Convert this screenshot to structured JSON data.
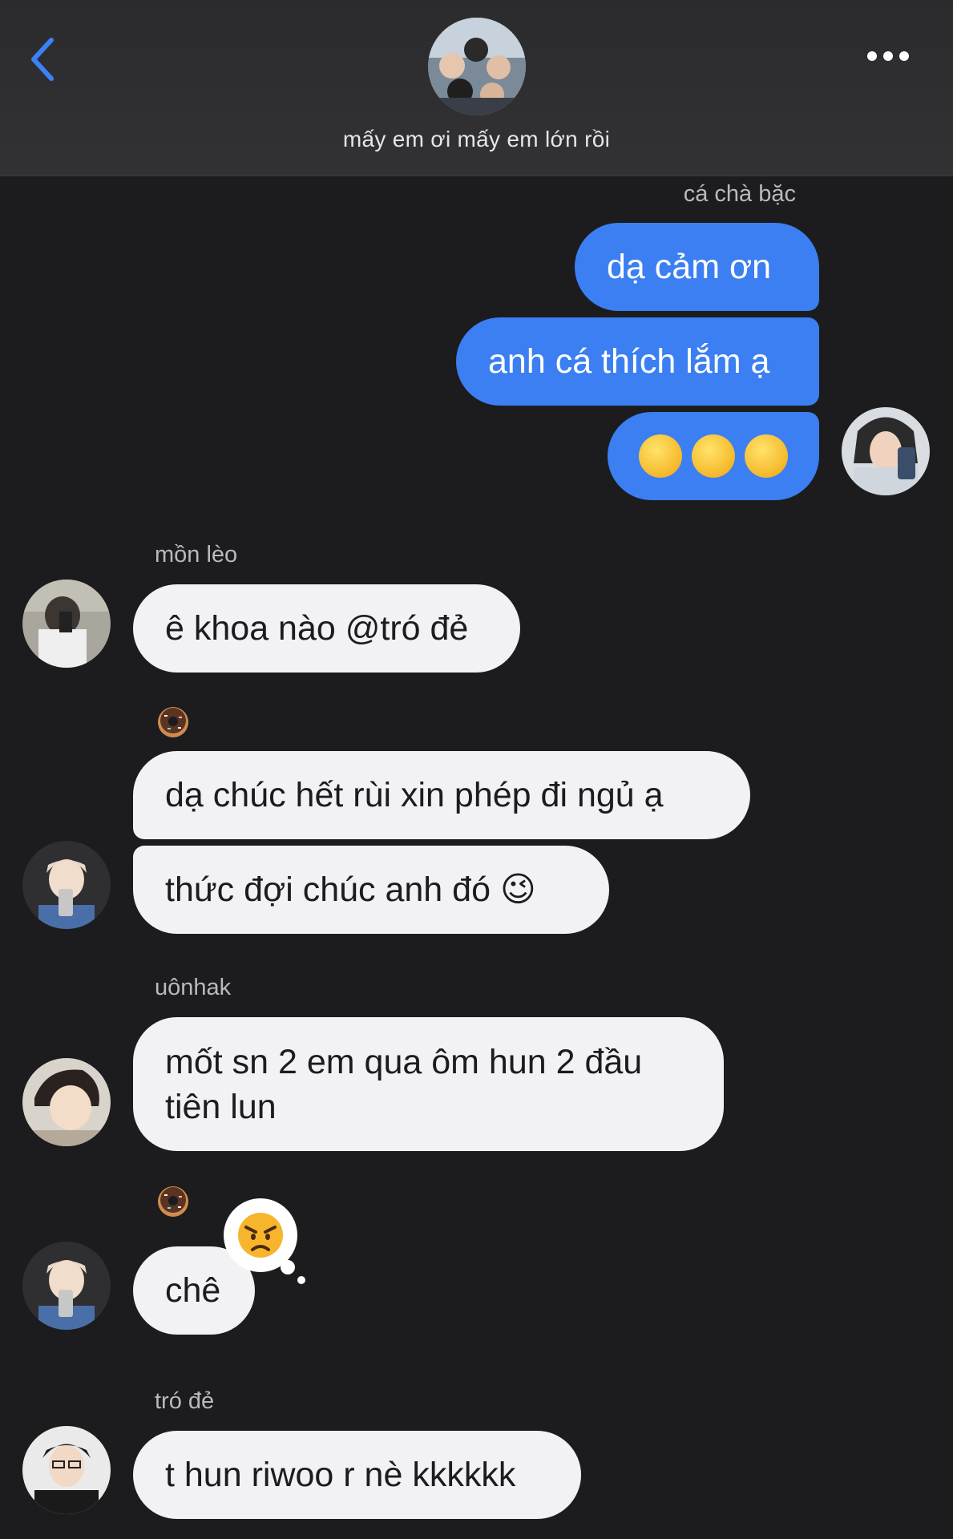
{
  "header": {
    "group_name": "mấy em ơi mấy em lớn rồi"
  },
  "messages": [
    {
      "sender": "cá chà bặc",
      "direction": "out",
      "lines": [
        "dạ cảm ơn",
        "anh cá thích lắm ạ",
        "🥺🥺🥺"
      ]
    },
    {
      "sender": "mồn lèo",
      "direction": "in",
      "lines": [
        "ê khoa nào @tró đẻ"
      ]
    },
    {
      "sender": "",
      "direction": "in",
      "reaction": "🍩",
      "lines": [
        "dạ chúc hết rùi xin phép đi ngủ ạ",
        "thức đợi chúc anh đó 😉"
      ]
    },
    {
      "sender": "uônhak",
      "direction": "in",
      "lines": [
        "mốt sn 2 em qua ôm hun 2 đầu",
        "tiên lun"
      ]
    },
    {
      "sender": "",
      "direction": "in",
      "reaction": "🍩",
      "sticker": "😠",
      "lines": [
        "chê"
      ]
    },
    {
      "sender": "tró đẻ",
      "direction": "in",
      "lines": [
        "t hun riwoo r nè kkkkkk"
      ]
    }
  ],
  "icons": {
    "back": "chevron-left-icon",
    "more": "more-dots-icon",
    "angry": "angry-face-icon",
    "donut": "donut-icon"
  },
  "colors": {
    "outgoing_bubble": "#3b7ff2",
    "incoming_bubble": "#f2f2f4",
    "background": "#1c1c1e",
    "accent": "#3b82f6"
  }
}
